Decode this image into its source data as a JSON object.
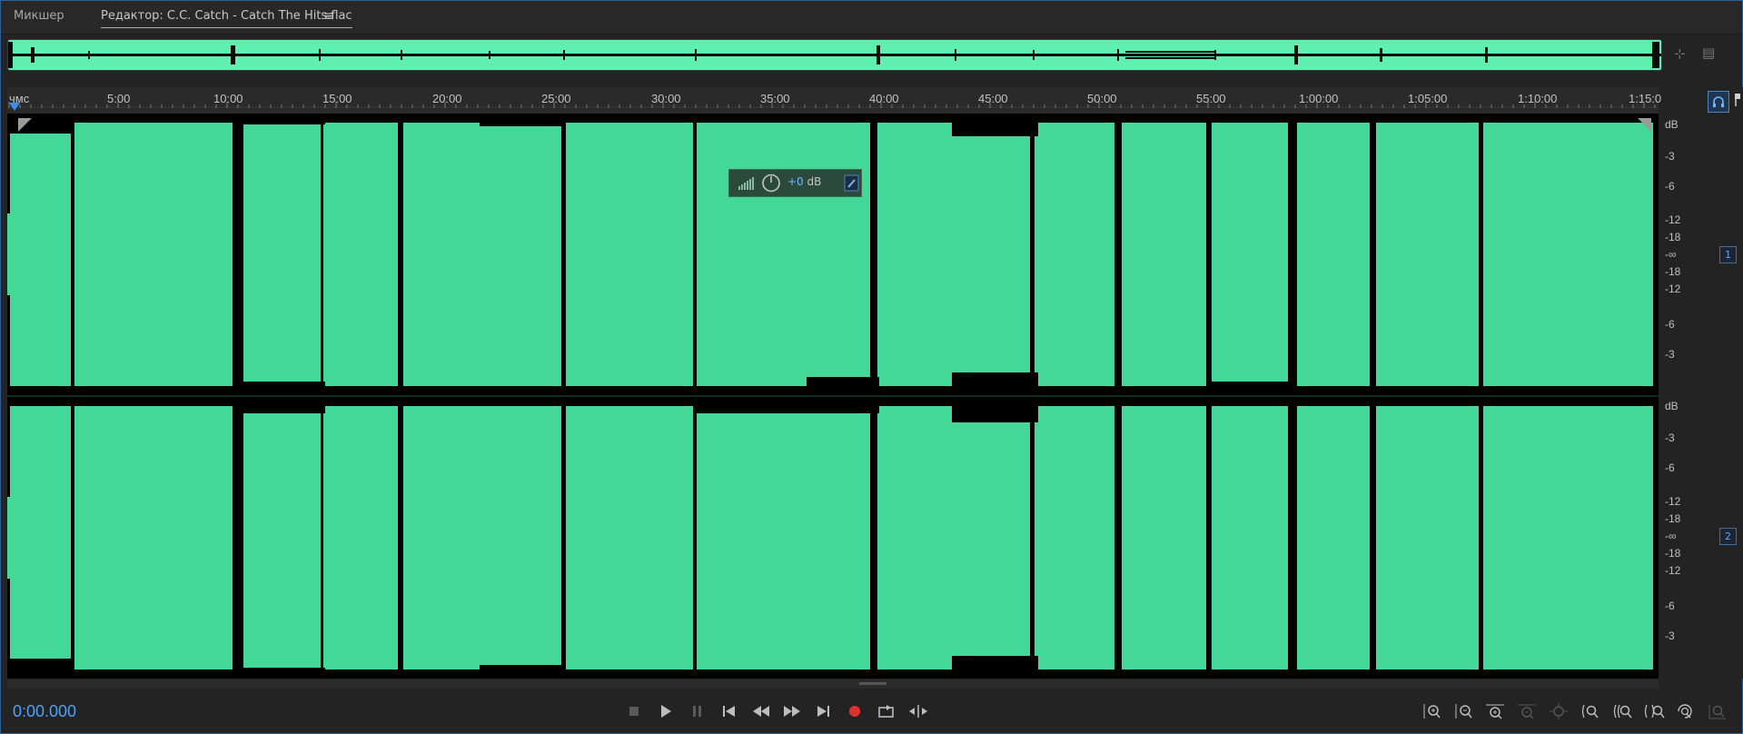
{
  "tabs": {
    "mixer_label": "Микшер",
    "editor_label": "Редактор: C.C. Catch - Catch The Hits.flac",
    "menu_glyph": "≡"
  },
  "ruler": {
    "unit_label": "чмс",
    "ticks": [
      "5:00",
      "10:00",
      "15:00",
      "20:00",
      "25:00",
      "30:00",
      "35:00",
      "40:00",
      "45:00",
      "50:00",
      "55:00",
      "1:00:00",
      "1:05:00",
      "1:10:00",
      "1:15:0"
    ]
  },
  "hud": {
    "value": "+0",
    "unit": " dB"
  },
  "db_scale": {
    "channel1": [
      "dB",
      "-3",
      "-6",
      "-12",
      "-18",
      "-∞",
      "-18",
      "-12",
      "-6",
      "-3"
    ],
    "channel2": [
      "dB",
      "-3",
      "-6",
      "-12",
      "-18",
      "-∞",
      "-18",
      "-12",
      "-6",
      "-3"
    ],
    "channel1_badge": "1",
    "channel2_badge": "2"
  },
  "transport": {
    "current_time": "0:00.000"
  },
  "colors": {
    "waveform": "#43d897",
    "overview": "#5ef0ae",
    "accent": "#4aa3ff",
    "record": "#e03030"
  },
  "icons": [
    "stop-icon",
    "play-icon",
    "pause-icon",
    "skip-to-start-icon",
    "rewind-icon",
    "fast-forward-icon",
    "skip-to-end-icon",
    "record-icon",
    "loop-icon",
    "skip-selection-icon",
    "zoom-in-amplitude-icon",
    "zoom-out-amplitude-icon",
    "zoom-in-time-icon",
    "zoom-out-time-icon",
    "zoom-full-icon",
    "zoom-in-left-icon",
    "zoom-in-right-icon",
    "zoom-selection-icon",
    "zoom-in-vertical-icon",
    "zoom-out-vertical-icon",
    "headphones-icon",
    "marker-pin-icon",
    "pin-icon",
    "power-knob-icon",
    "level-meter-icon"
  ]
}
